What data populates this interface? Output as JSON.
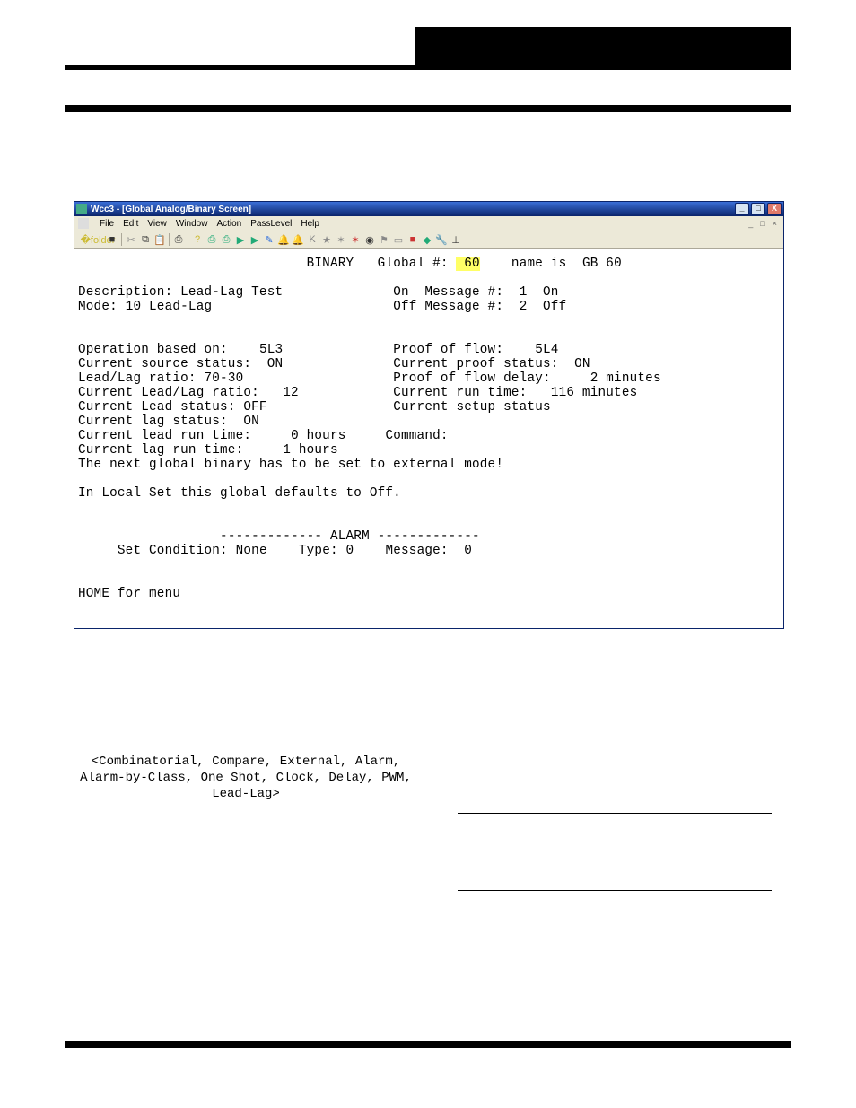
{
  "window": {
    "title": "Wcc3 - [Global Analog/Binary Screen]",
    "min_label": "_",
    "max_label": "□",
    "close_label": "X"
  },
  "menu": {
    "items": [
      "File",
      "Edit",
      "View",
      "Window",
      "Action",
      "PassLevel",
      "Help"
    ],
    "mdi": [
      "_",
      "□",
      "×"
    ]
  },
  "header": {
    "binary_label": "BINARY",
    "global_label": "Global #:",
    "global_num": " 60",
    "name_label": "name is",
    "name_value": "GB 60"
  },
  "left": {
    "description_label": "Description:",
    "description_value": "Lead-Lag Test",
    "mode_label": "Mode:",
    "mode_value": "10 Lead-Lag",
    "op_based_label": "Operation based on:",
    "op_based_value": "5L3",
    "src_status_label": "Current source status:",
    "src_status_value": "ON",
    "ll_ratio_label": "Lead/Lag ratio:",
    "ll_ratio_value": "70-30",
    "cur_ll_ratio_label": "Current Lead/Lag ratio:",
    "cur_ll_ratio_value": "12",
    "lead_status_label": "Current Lead status:",
    "lead_status_value": "OFF",
    "lag_status_label": "Current lag status:",
    "lag_status_value": "ON",
    "lead_run_label": "Current lead run time:",
    "lead_run_value": "0 hours",
    "lag_run_label": "Current lag run time:",
    "lag_run_value": "1 hours",
    "next_global_msg": "The next global binary has to be set to external mode!",
    "local_msg": "In Local Set this global defaults to Off."
  },
  "right": {
    "on_msg_label": "On  Message #:",
    "on_msg_num": "1",
    "on_msg_text": "On",
    "off_msg_label": "Off Message #:",
    "off_msg_num": "2",
    "off_msg_text": "Off",
    "proof_flow_label": "Proof of flow:",
    "proof_flow_value": "5L4",
    "proof_status_label": "Current proof status:",
    "proof_status_value": "ON",
    "proof_delay_label": "Proof of flow delay:",
    "proof_delay_value": "2 minutes",
    "run_time_label": "Current run time:",
    "run_time_value": "116 minutes",
    "setup_status_label": "Current setup status",
    "command_label": "Command:"
  },
  "alarm": {
    "divider": "------------- ALARM -------------",
    "set_cond_label": "Set Condition:",
    "set_cond_value": "None",
    "type_label": "Type:",
    "type_value": "0",
    "message_label": "Message:",
    "message_value": "0"
  },
  "footer": {
    "home_msg": "HOME for menu"
  },
  "page_body": {
    "line1": "<Combinatorial, Compare, External, Alarm,",
    "line2": "Alarm-by-Class, One Shot, Clock, Delay, PWM,",
    "line3": "Lead-Lag>"
  }
}
